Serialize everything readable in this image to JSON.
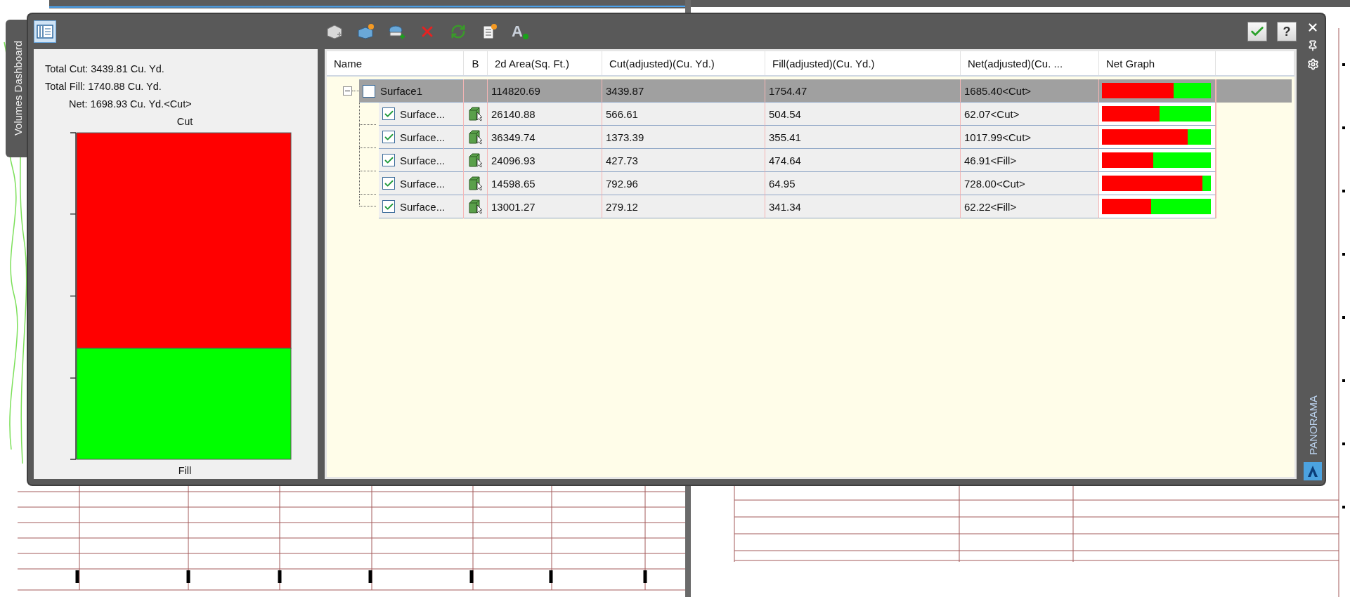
{
  "window": {
    "side_tab": "Volumes Dashboard",
    "side_title": "PANORAMA",
    "help_button": "?"
  },
  "toolbar": {
    "panel_toggle": {
      "selected": true
    },
    "tools": [
      {
        "kind": "surface"
      },
      {
        "kind": "new"
      },
      {
        "kind": "add"
      },
      {
        "kind": "delete"
      },
      {
        "kind": "refresh"
      },
      {
        "kind": "report"
      },
      {
        "kind": "label",
        "glyph": "A"
      }
    ]
  },
  "summary": {
    "lines": [
      "Total Cut: 3439.81 Cu. Yd.",
      "Total Fill: 1740.88 Cu. Yd.",
      "Net: 1698.93 Cu. Yd.<Cut>"
    ],
    "graph": {
      "top_label": "Cut",
      "bottom_label": "Fill",
      "level": 0.66
    }
  },
  "table": {
    "columns": [
      "Name",
      "B",
      "2d Area(Sq. Ft.)",
      "Cut(adjusted)(Cu. Yd.)",
      "Fill(adjusted)(Cu. Yd.)",
      "Net(adjusted)(Cu. ...",
      "Net Graph"
    ],
    "rows": [
      {
        "name": "Surface1",
        "checked": false,
        "expanded": true,
        "selected": true,
        "area": "114820.69",
        "cut": "3439.87",
        "fill": "1754.47",
        "net": "1685.40<Cut>",
        "level": 0.66,
        "children": [
          {
            "name": "Surface...",
            "checked": true,
            "selected": false,
            "area": "26140.88",
            "cut": "566.61",
            "fill": "504.54",
            "net": "62.07<Cut>",
            "level": 0.53
          },
          {
            "name": "Surface...",
            "checked": true,
            "selected": false,
            "area": "36349.74",
            "cut": "1373.39",
            "fill": "355.41",
            "net": "1017.99<Cut>",
            "level": 0.79
          },
          {
            "name": "Surface...",
            "checked": true,
            "selected": false,
            "area": "24096.93",
            "cut": "427.73",
            "fill": "474.64",
            "net": "46.91<Fill>",
            "level": 0.47
          },
          {
            "name": "Surface...",
            "checked": true,
            "selected": false,
            "area": "14598.65",
            "cut": "792.96",
            "fill": "64.95",
            "net": "728.00<Cut>",
            "level": 0.92
          },
          {
            "name": "Surface...",
            "checked": true,
            "selected": false,
            "area": "13001.27",
            "cut": "279.12",
            "fill": "341.34",
            "net": "62.22<Fill>",
            "level": 0.45
          }
        ]
      }
    ]
  }
}
